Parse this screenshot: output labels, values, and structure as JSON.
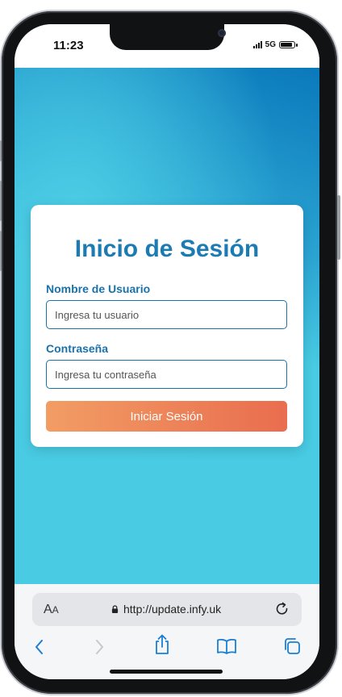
{
  "status_bar": {
    "time": "11:23",
    "network": "5G",
    "battery_level": 0.9
  },
  "login": {
    "title": "Inicio de Sesión",
    "username_label": "Nombre de Usuario",
    "username_placeholder": "Ingresa tu usuario",
    "password_label": "Contraseña",
    "password_placeholder": "Ingresa tu contraseña",
    "submit_label": "Iniciar Sesión"
  },
  "browser": {
    "aa_label_large": "A",
    "aa_label_small": "A",
    "url": "http://update.infy.uk"
  },
  "colors": {
    "accent": "#1c7bb3",
    "button_start": "#f29d64",
    "button_end": "#e96d4f",
    "background": "#48cbe3"
  }
}
